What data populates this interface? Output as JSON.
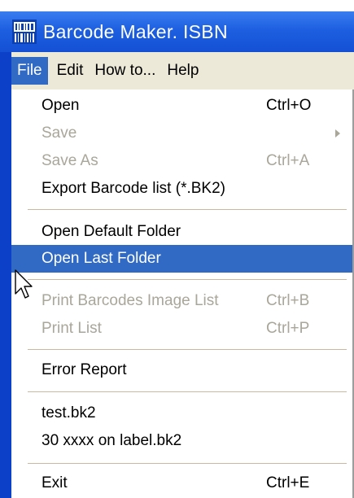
{
  "window": {
    "title": "Barcode Maker. ISBN",
    "icon": "barcode-app-icon"
  },
  "menubar": {
    "items": [
      {
        "label": "File",
        "active": true
      },
      {
        "label": "Edit"
      },
      {
        "label": "How to..."
      },
      {
        "label": "Help"
      }
    ]
  },
  "file_menu": {
    "open": {
      "label": "Open",
      "shortcut": "Ctrl+O"
    },
    "save": {
      "label": "Save",
      "disabled": true,
      "has_submenu": true
    },
    "save_as": {
      "label": "Save As",
      "shortcut": "Ctrl+A",
      "disabled": true
    },
    "export": {
      "label": "Export Barcode list (*.BK2)"
    },
    "open_default": {
      "label": "Open Default Folder"
    },
    "open_last": {
      "label": "Open Last Folder",
      "highlighted": true
    },
    "print_barcodes": {
      "label": "Print Barcodes Image List",
      "shortcut": "Ctrl+B",
      "disabled": true
    },
    "print_list": {
      "label": "Print List",
      "shortcut": "Ctrl+P",
      "disabled": true
    },
    "error_report": {
      "label": "Error Report"
    },
    "recent_1": {
      "label": "test.bk2"
    },
    "recent_2": {
      "label": "30 xxxx on label.bk2"
    },
    "exit": {
      "label": "Exit",
      "shortcut": "Ctrl+E"
    }
  },
  "colors": {
    "titlebar": "#1d5fe0",
    "highlight": "#316ac5",
    "menubar_bg": "#ece9d8",
    "disabled_text": "#a9a69a"
  }
}
